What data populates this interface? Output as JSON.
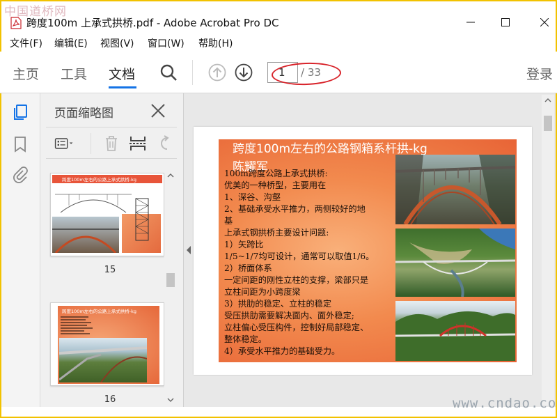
{
  "watermark_top": "中国道桥网",
  "watermark_bottom": "www.cndao.com",
  "window": {
    "title": "跨度100m 上承式拱桥.pdf - Adobe Acrobat Pro DC"
  },
  "menu": [
    "文件(F)",
    "编辑(E)",
    "视图(V)",
    "窗口(W)",
    "帮助(H)"
  ],
  "toolbar": {
    "tabs": [
      "主页",
      "工具",
      "文档"
    ],
    "current_page": "1",
    "total_pages": "/ 33",
    "login": "登录",
    "accent": "#1473e6"
  },
  "rail": {
    "icons": [
      "page-thumbnails-icon",
      "bookmark-icon",
      "attachment-icon"
    ]
  },
  "thumbnail_panel": {
    "title": "页面缩略图",
    "thumbnails": [
      {
        "label": "15",
        "title": "跨度100m左右的公路上承式拱桥-kg"
      },
      {
        "label": "16",
        "title": "跨度100m左右的公路上承式拱桥-kg"
      }
    ]
  },
  "slide": {
    "title": "跨度100m左右的公路钢箱系杆拱-kg",
    "author": "陈耀军",
    "lines": [
      "100m跨度公路上承式拱桥:",
      "优美的一种桥型，主要用在",
      "1、深谷、沟壑",
      "2、基础承受水平推力，两侧较好的地",
      "基",
      "上承式钢拱桥主要设计问题:",
      "1）矢跨比",
      "1/5~1/7均可设计，通常可以取值1/6。",
      "2）桥面体系",
      "一定间距的刚性立柱的支撑，梁部只是",
      "立柱间距为小跨度梁",
      "3）拱肋的稳定、立柱的稳定",
      "受压拱肋需要解决面内、面外稳定;",
      "立柱偏心受压构件，控制好局部稳定、",
      "整体稳定。",
      "4）承受水平推力的基础受力。"
    ]
  }
}
